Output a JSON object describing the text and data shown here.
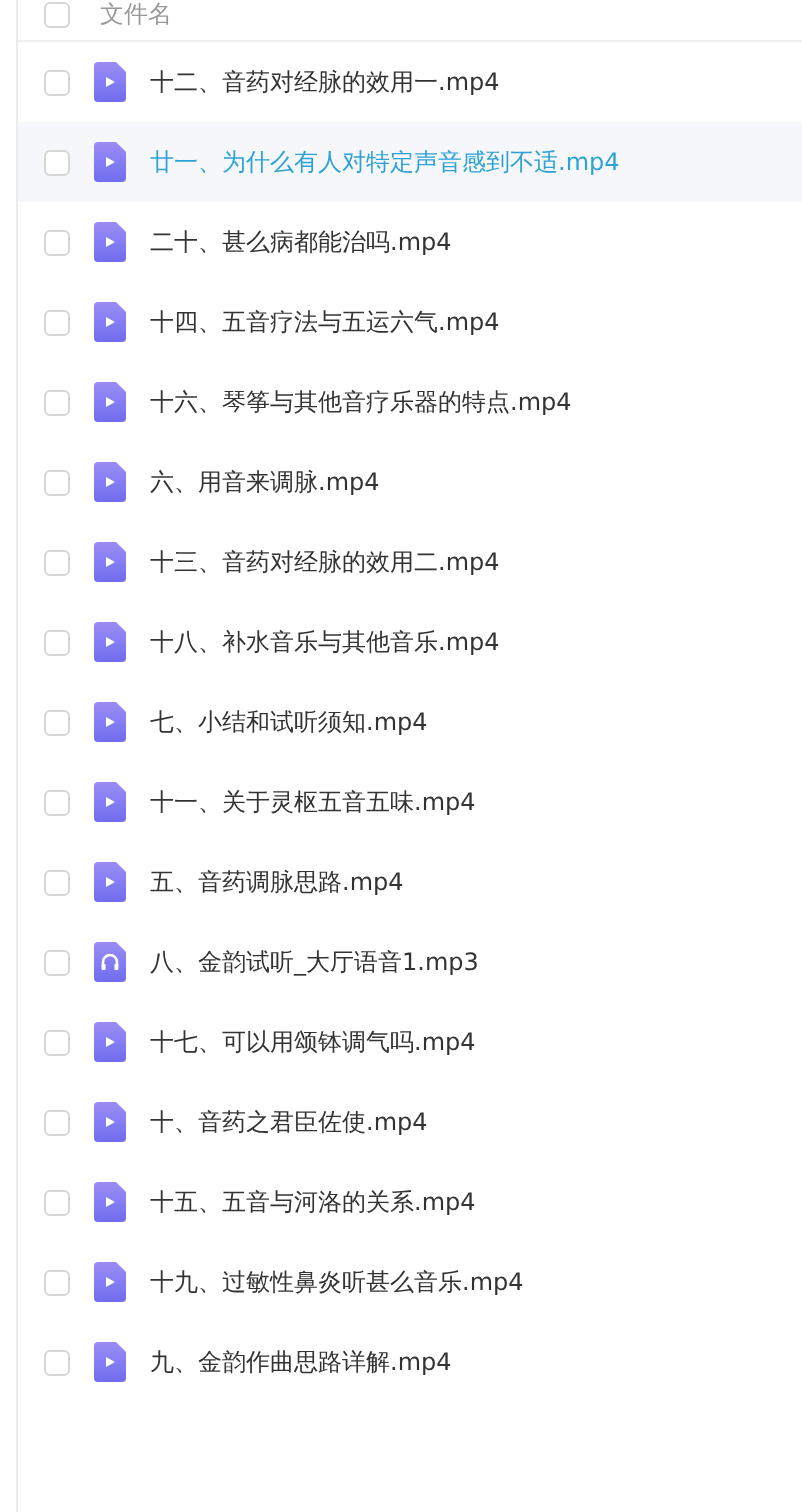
{
  "header": {
    "label": "文件名",
    "checked": false
  },
  "files": [
    {
      "name": "十二、音药对经脉的效用一.mp4",
      "kind": "video",
      "checked": false,
      "highlighted": false
    },
    {
      "name": "廿一、为什么有人对特定声音感到不适.mp4",
      "kind": "video",
      "checked": false,
      "highlighted": true
    },
    {
      "name": "二十、甚么病都能治吗.mp4",
      "kind": "video",
      "checked": false,
      "highlighted": false
    },
    {
      "name": "十四、五音疗法与五运六气.mp4",
      "kind": "video",
      "checked": false,
      "highlighted": false
    },
    {
      "name": "十六、琴筝与其他音疗乐器的特点.mp4",
      "kind": "video",
      "checked": false,
      "highlighted": false
    },
    {
      "name": "六、用音来调脉.mp4",
      "kind": "video",
      "checked": false,
      "highlighted": false
    },
    {
      "name": "十三、音药对经脉的效用二.mp4",
      "kind": "video",
      "checked": false,
      "highlighted": false
    },
    {
      "name": "十八、补水音乐与其他音乐.mp4",
      "kind": "video",
      "checked": false,
      "highlighted": false
    },
    {
      "name": "七、小结和试听须知.mp4",
      "kind": "video",
      "checked": false,
      "highlighted": false
    },
    {
      "name": "十一、关于灵枢五音五味.mp4",
      "kind": "video",
      "checked": false,
      "highlighted": false
    },
    {
      "name": "五、音药调脉思路.mp4",
      "kind": "video",
      "checked": false,
      "highlighted": false
    },
    {
      "name": "八、金韵试听_大厅语音1.mp3",
      "kind": "audio",
      "checked": false,
      "highlighted": false
    },
    {
      "name": "十七、可以用颂钵调气吗.mp4",
      "kind": "video",
      "checked": false,
      "highlighted": false
    },
    {
      "name": "十、音药之君臣佐使.mp4",
      "kind": "video",
      "checked": false,
      "highlighted": false
    },
    {
      "name": "十五、五音与河洛的关系.mp4",
      "kind": "video",
      "checked": false,
      "highlighted": false
    },
    {
      "name": "十九、过敏性鼻炎听甚么音乐.mp4",
      "kind": "video",
      "checked": false,
      "highlighted": false
    },
    {
      "name": "九、金韵作曲思路详解.mp4",
      "kind": "video",
      "checked": false,
      "highlighted": false
    }
  ]
}
